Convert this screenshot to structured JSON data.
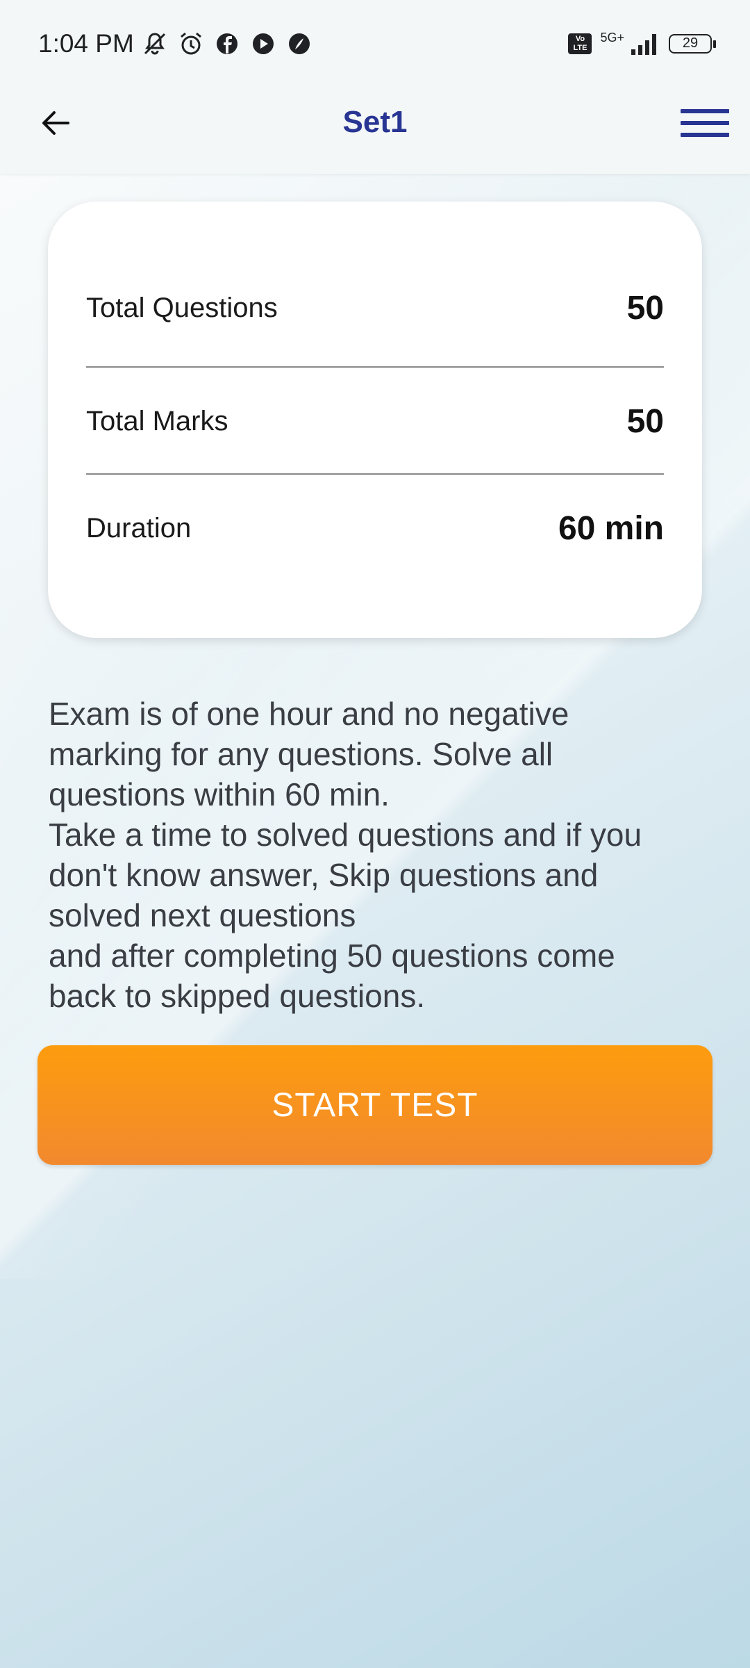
{
  "status_bar": {
    "time": "1:04 PM",
    "network_type": "5G+",
    "volte_label": "Vo LTE",
    "battery": "29",
    "left_icons": [
      "mute-notifications-icon",
      "alarm-icon",
      "facebook-icon",
      "youtube-icon",
      "app-notification-icon"
    ],
    "right_icons": [
      "volte-icon",
      "signal-icon",
      "battery-icon"
    ]
  },
  "app_bar": {
    "title": "Set1",
    "back_icon": "arrow-left-icon",
    "menu_icon": "hamburger-menu-icon"
  },
  "info": {
    "rows": [
      {
        "label": "Total Questions",
        "value": "50"
      },
      {
        "label": "Total Marks",
        "value": "50"
      },
      {
        "label": "Duration",
        "value": "60 min"
      }
    ]
  },
  "description": "Exam is of one hour and no negative\nmarking for any questions. Solve all\nquestions within 60 min.\nTake a time to solved questions and if you\ndon't  know answer, Skip questions and\nsolved next questions\nand after completing 50 questions come\nback to skipped questions.",
  "start_button": {
    "label": "START TEST"
  },
  "colors": {
    "title": "#283593",
    "button_top": "#fd9c0e",
    "button_bottom": "#f2892e"
  }
}
